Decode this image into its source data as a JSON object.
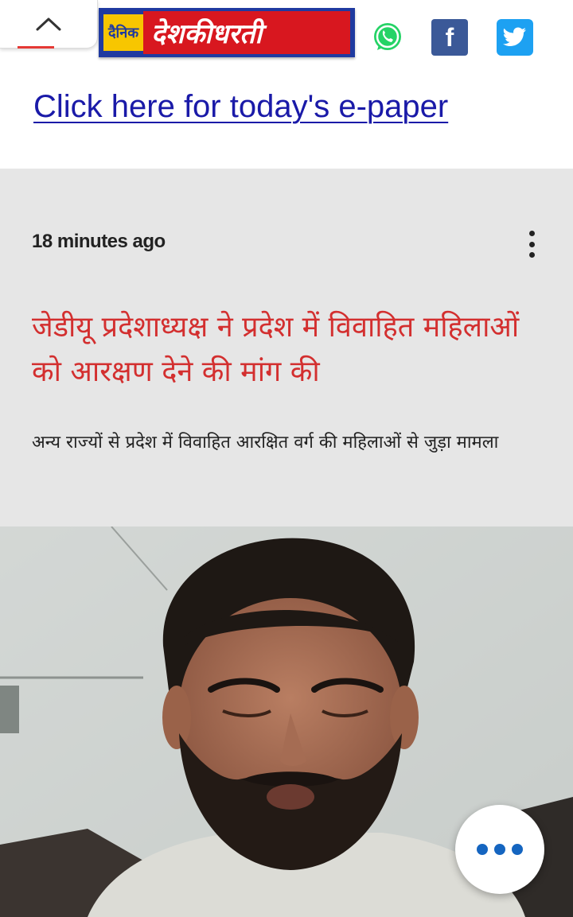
{
  "header": {
    "logo_small": "दैनिक",
    "logo_big": "देशकीधरती",
    "social_icons": [
      "whatsapp-icon",
      "facebook-icon",
      "twitter-icon"
    ],
    "facebook_glyph": "f"
  },
  "epaper_link": "Click here for today's e-paper",
  "article": {
    "timestamp": "18 minutes ago",
    "headline": "जेडीयू प्रदेशाध्यक्ष ने प्रदेश में विवाहित महिलाओं को आरक्षण देने की मांग की",
    "summary": "अन्य राज्यों से प्रदेश में विवाहित आरक्षित वर्ग की महिलाओं से जुड़ा मामला"
  },
  "colors": {
    "headline": "#d32f2f",
    "link": "#1a1aa8",
    "card_bg": "#e6e6e6",
    "logo_red": "#d8171f",
    "logo_blue": "#1f3aa0",
    "logo_yellow": "#f7c600",
    "fab_dots": "#1565c0"
  }
}
